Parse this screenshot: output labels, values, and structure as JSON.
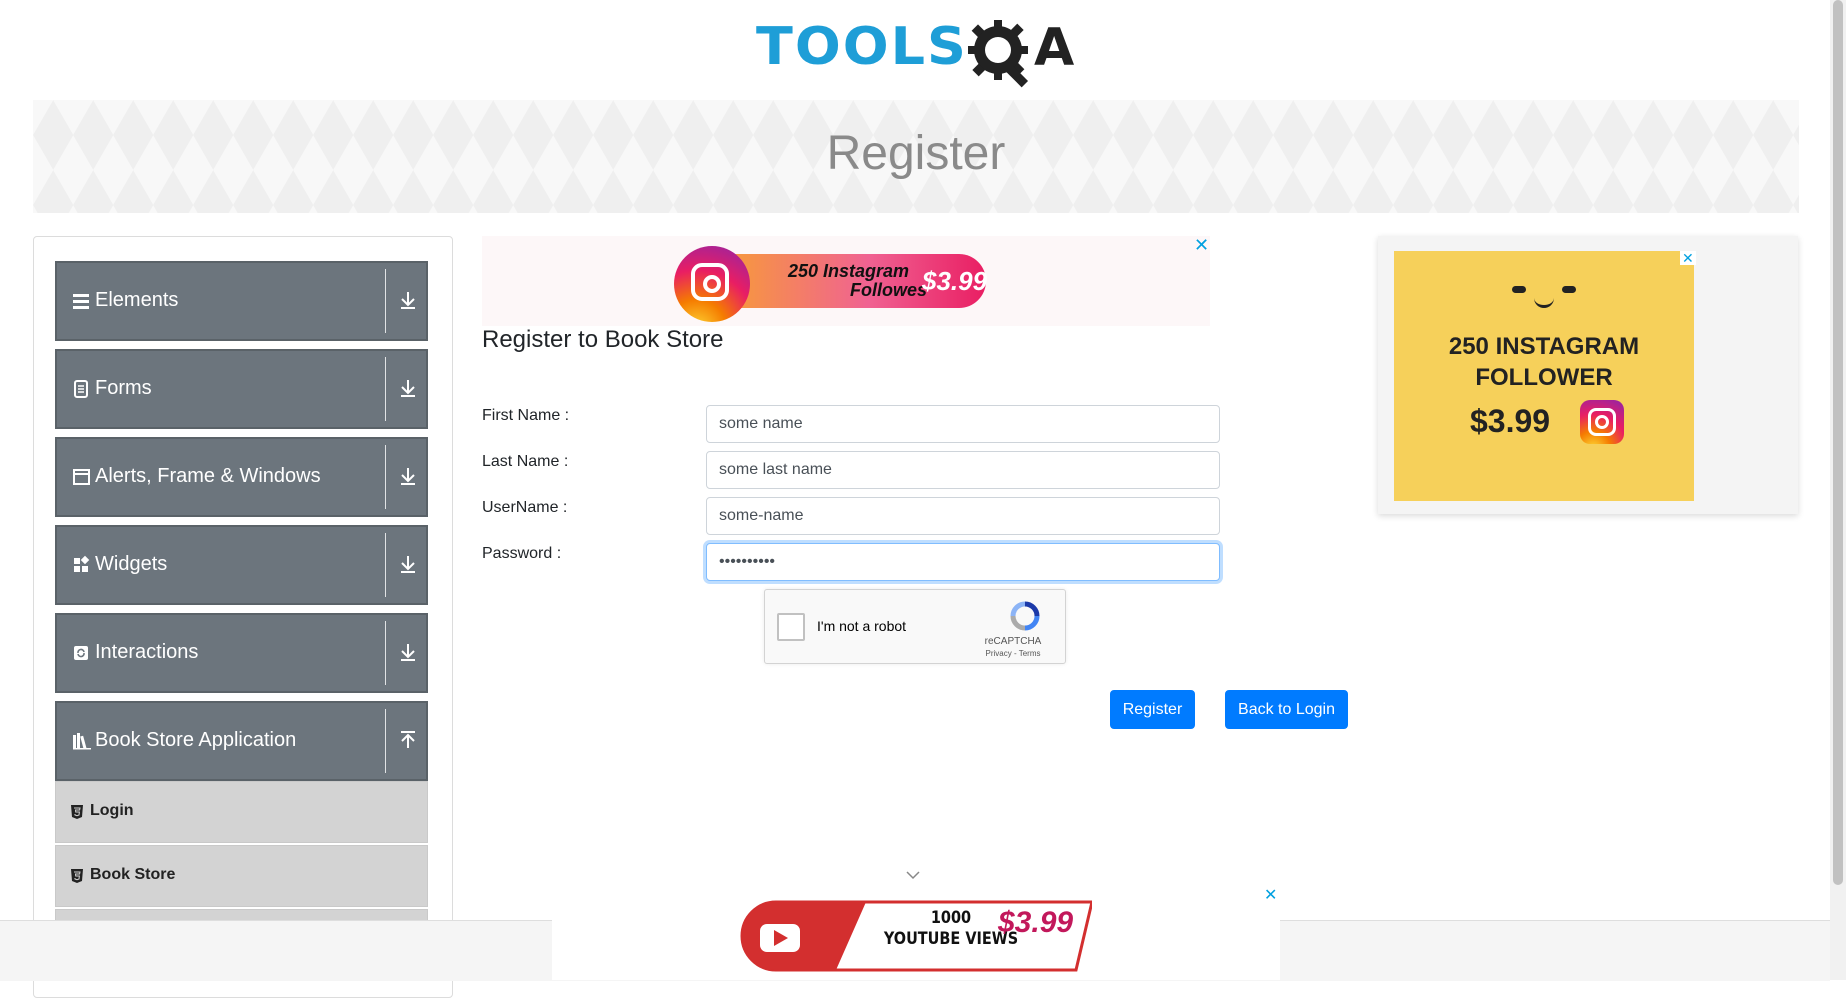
{
  "header": {
    "logo_text": "TOOLS",
    "logo_text_end": "A"
  },
  "banner": {
    "title": "Register"
  },
  "sidebar": {
    "groups": [
      {
        "label": "Elements",
        "icon": "hamburger-icon"
      },
      {
        "label": "Forms",
        "icon": "document-icon"
      },
      {
        "label": "Alerts, Frame & Windows",
        "icon": "window-icon"
      },
      {
        "label": "Widgets",
        "icon": "widgets-icon"
      },
      {
        "label": "Interactions",
        "icon": "refresh-icon"
      },
      {
        "label": "Book Store Application",
        "icon": "books-icon",
        "expanded": true
      }
    ],
    "book_store_items": [
      {
        "label": "Login",
        "icon": "html5-icon"
      },
      {
        "label": "Book Store",
        "icon": "html5-icon"
      }
    ]
  },
  "ads": {
    "top": {
      "line1": "250 Instagram",
      "line2": "Followes",
      "price": "$3.99"
    },
    "right": {
      "line1": "250 INSTAGRAM",
      "line2": "FOLLOWER",
      "price": "$3.99"
    },
    "bottom": {
      "line1": "1000",
      "line2": "YOUTUBE VIEWS",
      "price": "$3.99"
    },
    "close_glyph": "✕"
  },
  "form": {
    "title": "Register to Book Store",
    "fields": [
      {
        "label": "First Name :",
        "value": "some name"
      },
      {
        "label": "Last Name :",
        "value": "some last name"
      },
      {
        "label": "UserName :",
        "value": "some-name"
      },
      {
        "label": "Password :",
        "value": "••••••••••"
      }
    ],
    "captcha": {
      "label": "I'm not a robot",
      "brand": "reCAPTCHA",
      "links": "Privacy - Terms"
    },
    "register_button": "Register",
    "back_button": "Back to Login"
  },
  "colors": {
    "primary": "#007bff",
    "sidebar_group": "#6c757d",
    "logo_blue": "#1e9ed7"
  }
}
